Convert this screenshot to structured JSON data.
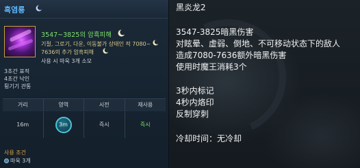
{
  "tooltip": {
    "title": "흑염룡",
    "damage": "3547~3825의 암흑피해",
    "desc_lines": [
      "기절, 그로기, 다운, 이동불가 상태인 적 7080~",
      "7636의 추가 암흑피해"
    ],
    "cost": "사용 시 마욱 3개 소모",
    "effects": [
      "3초간 표적",
      "4초간 낙인",
      "튕기기 관통"
    ],
    "stats": {
      "headers": [
        "거리",
        "영역",
        "시전",
        "재사용"
      ],
      "values": [
        "16m",
        "3m",
        "즉시",
        "즉시"
      ]
    },
    "requirement_label": "사용 조건",
    "requirement_item": "마욱 3개"
  },
  "translation": {
    "lines": [
      "黑炎龙2",
      "",
      "3547-3825暗黑伤害",
      "对眩晕、虚弱、倒地、不可移动状态下的敌人",
      "造成7080-7636额外暗黑伤害",
      "使用时魔王消耗3个",
      "",
      "3秒内标记",
      "4秒内烙印",
      "反制穿刺",
      "",
      "冷却时间：无冷却"
    ]
  },
  "colors": {
    "title": "#5eb8ff",
    "damage": "#7ee06a",
    "desc": "#d9c987",
    "requirement": "#e0a23a"
  },
  "icons": [
    "moon-crescent-icon",
    "skill-icon",
    "range-circle-icon",
    "requirement-orb-icon"
  ]
}
